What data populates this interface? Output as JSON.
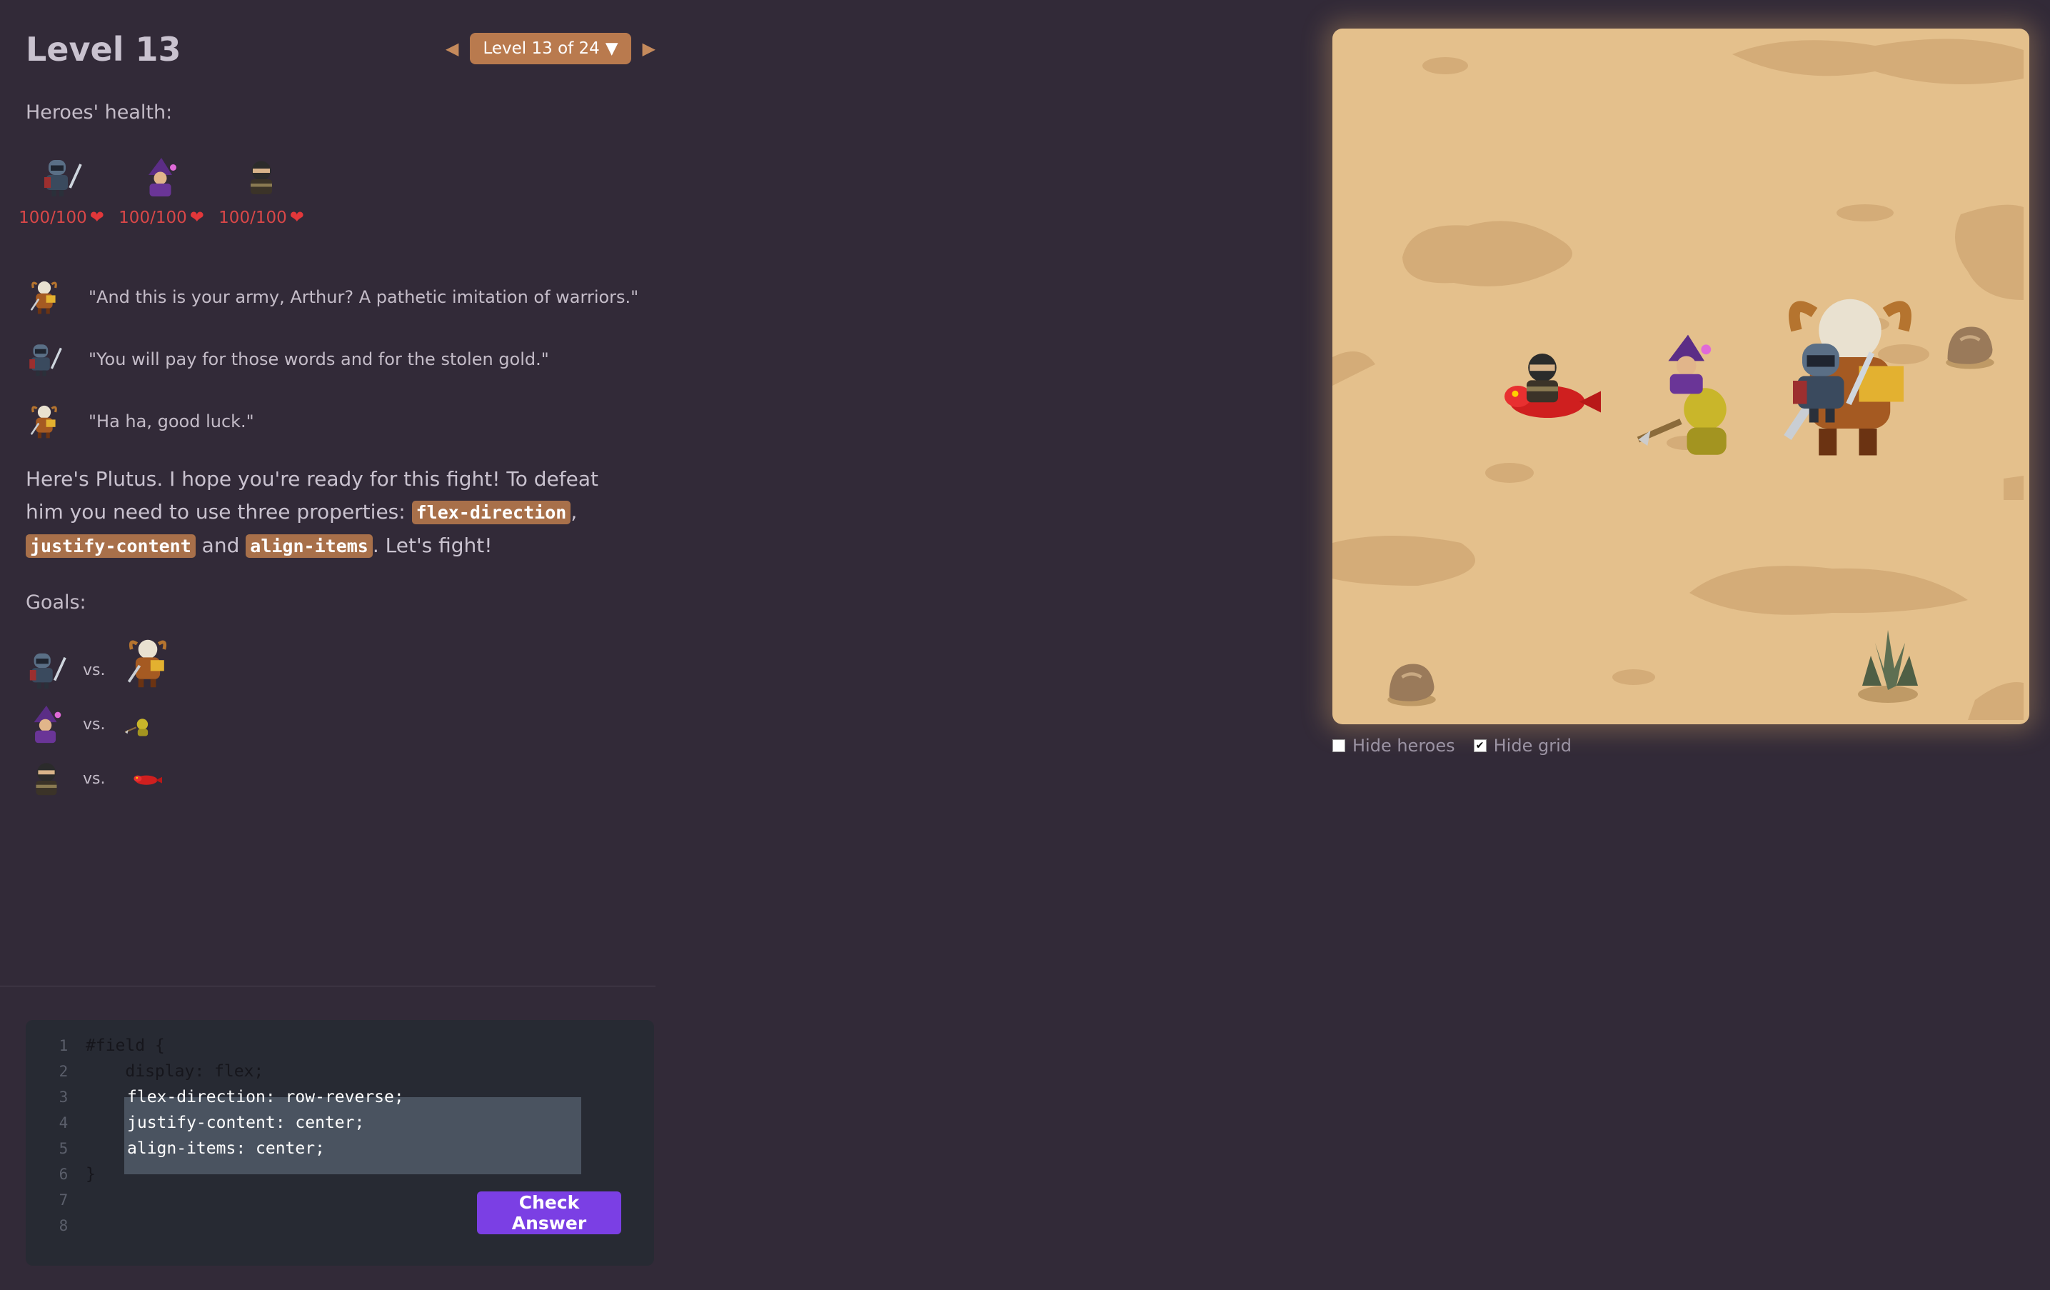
{
  "header": {
    "title": "Level 13",
    "level_selector": "Level 13 of 24",
    "prev_icon": "triangle-left-icon",
    "next_icon": "triangle-right-icon",
    "dropdown_icon": "triangle-down-icon"
  },
  "health": {
    "label": "Heroes' health:",
    "heroes": [
      {
        "name": "knight",
        "hp": "100/100",
        "icon": "knight-sprite-icon"
      },
      {
        "name": "wizard",
        "hp": "100/100",
        "icon": "wizard-sprite-icon"
      },
      {
        "name": "ninja",
        "hp": "100/100",
        "icon": "ninja-sprite-icon"
      }
    ],
    "heart_icon": "heart-icon"
  },
  "dialogue": [
    {
      "speaker": "plutus",
      "text": "\"And this is your army, Arthur? A pathetic imitation of warriors.\""
    },
    {
      "speaker": "knight",
      "text": "\"You will pay for those words and for the stolen gold.\""
    },
    {
      "speaker": "plutus",
      "text": "\"Ha ha, good luck.\""
    }
  ],
  "description": {
    "part1": "Here's Plutus. I hope you're ready for this fight! To defeat him you need to use three properties: ",
    "code1": "flex-direction",
    "sep1": ", ",
    "code2": "justify-content",
    "sep2": " and ",
    "code3": "align-items",
    "part2": ". Let's fight!"
  },
  "goals": {
    "label": "Goals:",
    "vs": "vs.",
    "pairs": [
      {
        "hero": "knight",
        "enemy": "plutus"
      },
      {
        "hero": "wizard",
        "enemy": "goblin"
      },
      {
        "hero": "ninja",
        "enemy": "red-dragon"
      }
    ]
  },
  "editor": {
    "lines": [
      {
        "num": "1",
        "code": "#field {"
      },
      {
        "num": "2",
        "code": "    display: flex;"
      },
      {
        "num": "3",
        "code": "flex-direction: row-reverse;"
      },
      {
        "num": "4",
        "code": "justify-content: center;"
      },
      {
        "num": "5",
        "code": "align-items: center;"
      },
      {
        "num": "6",
        "code": "}"
      },
      {
        "num": "7",
        "code": ""
      },
      {
        "num": "8",
        "code": ""
      }
    ],
    "check_button": "Check Answer"
  },
  "options": {
    "hide_heroes": {
      "label": "Hide heroes",
      "checked": false
    },
    "hide_grid": {
      "label": "Hide grid",
      "checked": true
    }
  },
  "colors": {
    "background": "#322a38",
    "accent": "#b97a4e",
    "check_button": "#7b3fe4",
    "health": "#d94748",
    "board": "#e4c08c"
  }
}
